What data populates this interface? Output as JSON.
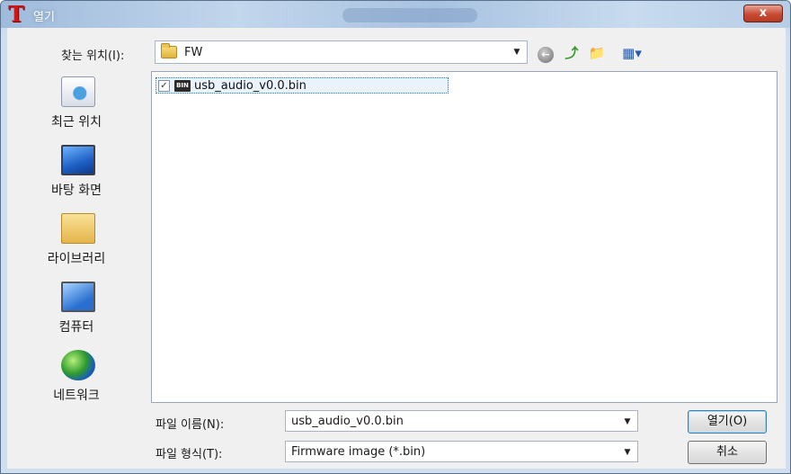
{
  "window": {
    "title": "열기",
    "app_icon_glyph": "T",
    "close_glyph": "x"
  },
  "toolbar": {
    "lookin_label": "찾는 위치(I):",
    "lookin_value": "FW",
    "back_glyph": "←",
    "up_glyph": "⤴",
    "newfolder_glyph": "📁",
    "views_glyph": "▦▾"
  },
  "places": [
    {
      "label": "최근 위치",
      "icon": "recent-places-icon"
    },
    {
      "label": "바탕 화면",
      "icon": "desktop-icon"
    },
    {
      "label": "라이브러리",
      "icon": "library-icon"
    },
    {
      "label": "컴퓨터",
      "icon": "computer-icon"
    },
    {
      "label": "네트워크",
      "icon": "network-icon"
    }
  ],
  "files": [
    {
      "name": "usb_audio_v0.0.bin",
      "checked": true,
      "icon_text": "BIN"
    }
  ],
  "form": {
    "filename_label": "파일 이름(N):",
    "filename_value": "usb_audio_v0.0.bin",
    "filetype_label": "파일 형식(T):",
    "filetype_value": "Firmware image (*.bin)",
    "open_button": "열기(O)",
    "cancel_button": "취소"
  },
  "colors": {
    "title_icon": "#d01818",
    "close_button": "#c84a34",
    "selection_border": "#3a6ea8"
  }
}
